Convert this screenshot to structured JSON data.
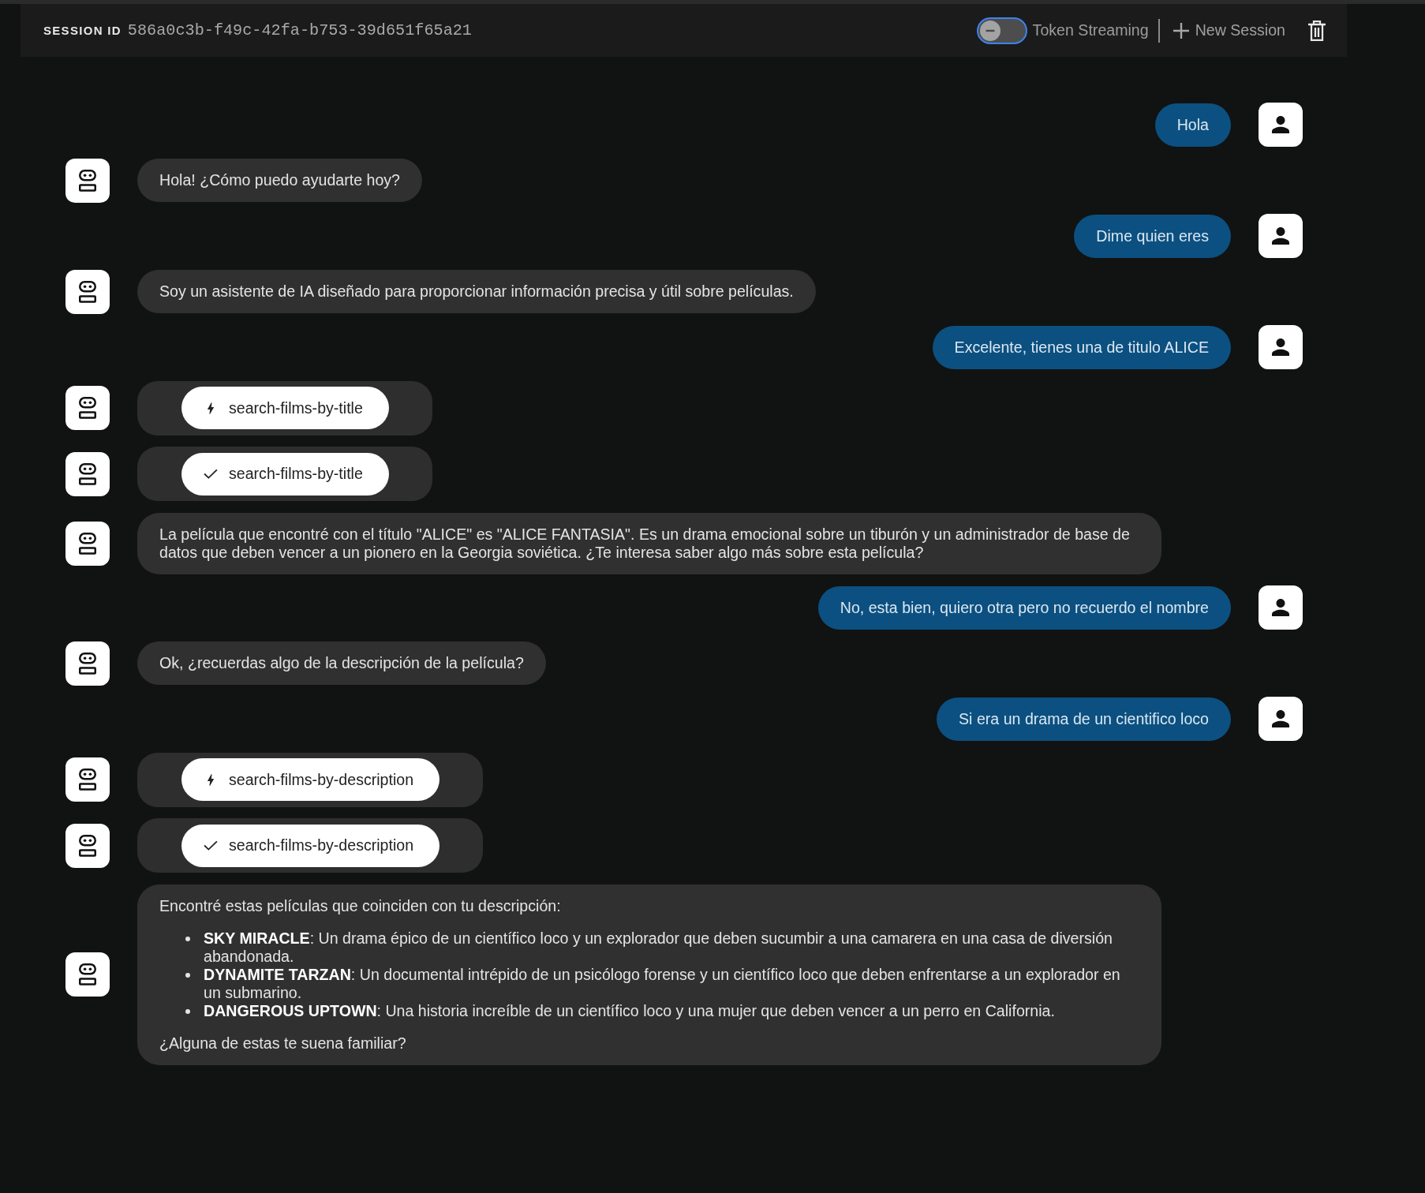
{
  "header": {
    "session_label": "SESSION ID",
    "session_id": "586a0c3b-f49c-42fa-b753-39d651f65a21",
    "token_streaming": {
      "label": "Token Streaming",
      "on": false
    },
    "new_session": {
      "label": "New Session"
    }
  },
  "messages": [
    {
      "kind": "user",
      "text": "Hola"
    },
    {
      "kind": "assistant",
      "text": "Hola! ¿Cómo puedo ayudarte hoy?"
    },
    {
      "kind": "user",
      "text": "Dime quien eres"
    },
    {
      "kind": "assistant",
      "text": "Soy un asistente de IA diseñado para proporcionar información precisa y útil sobre películas."
    },
    {
      "kind": "user",
      "text": "Excelente, tienes una de titulo ALICE"
    },
    {
      "kind": "tool_call",
      "tool": "search-films-by-title",
      "done": false
    },
    {
      "kind": "tool_call",
      "tool": "search-films-by-title",
      "done": true
    },
    {
      "kind": "assistant",
      "text": "La película que encontré con el título \"ALICE\" es \"ALICE FANTASIA\". Es un drama emocional sobre un tiburón y un administrador de base de datos que deben vencer a un pionero en la Georgia soviética. ¿Te interesa saber algo más sobre esta película?"
    },
    {
      "kind": "user",
      "text": "No, esta bien, quiero otra pero no recuerdo el nombre"
    },
    {
      "kind": "assistant",
      "text": "Ok, ¿recuerdas algo de la descripción de la película?"
    },
    {
      "kind": "user",
      "text": "Si era un drama de un cientifico loco"
    },
    {
      "kind": "tool_call",
      "tool": "search-films-by-description",
      "done": false
    },
    {
      "kind": "tool_call",
      "tool": "search-films-by-description",
      "done": true
    },
    {
      "kind": "assistant_list",
      "blocks": [
        {
          "kind": "paragraph",
          "text": "Encontré estas películas que coinciden con tu descripción:"
        },
        {
          "kind": "list",
          "items": [
            "**SKY MIRACLE**: Un drama épico de un científico loco y un explorador que deben sucumbir a una camarera en una casa de diversión abandonada.",
            "**DYNAMITE TARZAN**: Un documental intrépido de un psicólogo forense y un científico loco que deben enfrentarse a un explorador en un submarino.",
            "**DANGEROUS UPTOWN**: Una historia increíble de un científico loco y una mujer que deben vencer a un perro en California."
          ]
        },
        {
          "kind": "paragraph",
          "text": "¿Alguna de estas te suena familiar?"
        }
      ]
    }
  ]
}
